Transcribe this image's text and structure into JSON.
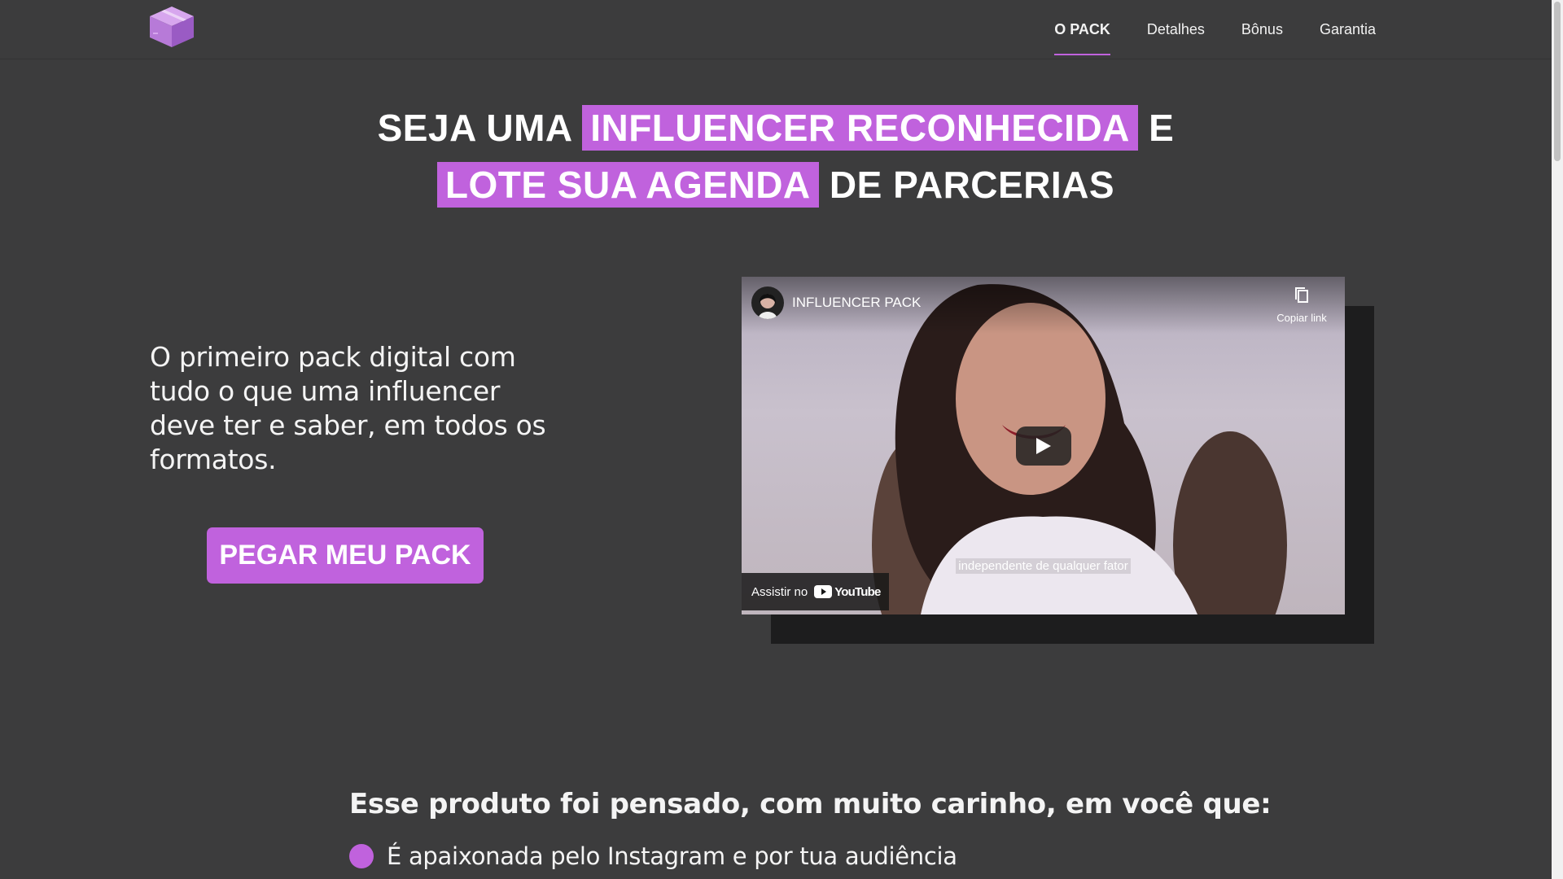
{
  "nav": {
    "logo_icon": "box-icon",
    "items": [
      {
        "label": "O PACK",
        "active": true
      },
      {
        "label": "Detalhes",
        "active": false
      },
      {
        "label": "Bônus",
        "active": false
      },
      {
        "label": "Garantia",
        "active": false
      }
    ]
  },
  "hero": {
    "line1_pre": "SEJA UMA",
    "line1_highlight": "INFLUENCER RECONHECIDA",
    "line1_post": "E",
    "line2_highlight": "LOTE SUA AGENDA",
    "line2_post": "DE PARCERIAS"
  },
  "lead_text": "O primeiro pack digital com tudo o que uma influencer deve ter e saber, em todos os formatos.",
  "cta_label": "PEGAR MEU PACK",
  "video": {
    "title": "INFLUENCER PACK",
    "copy_label": "Copiar link",
    "caption": "independente de qualquer fator",
    "watch_label": "Assistir no",
    "youtube_label": "YouTube"
  },
  "section": {
    "heading": "Esse produto foi pensado, com muito carinho, em você que:",
    "bullets": [
      "É apaixonada pelo Instagram e por tua audiência"
    ]
  },
  "colors": {
    "accent": "#c062dd",
    "background": "#3c3c3d",
    "video_shadow": "#1d1d1e"
  }
}
